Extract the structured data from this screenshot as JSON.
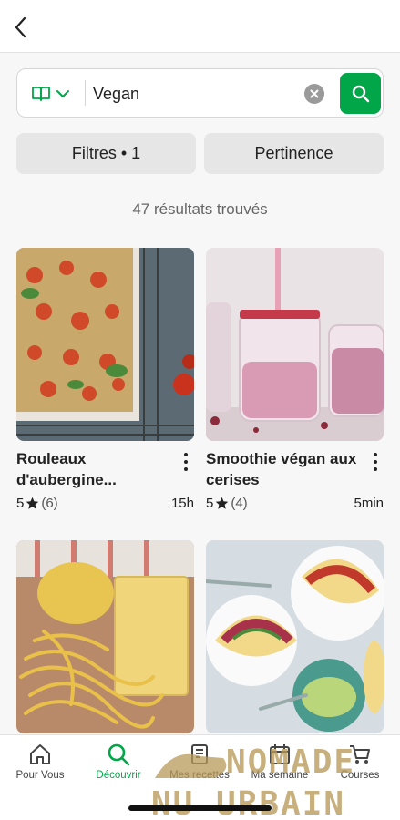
{
  "search": {
    "value": "Vegan"
  },
  "controls": {
    "filters_label": "Filtres • 1",
    "sort_label": "Pertinence"
  },
  "results": {
    "count_label": "47 résultats trouvés"
  },
  "recipes": [
    {
      "title": "Rouleaux d'aubergine...",
      "rating": "5",
      "reviews": "(6)",
      "duration": "15h"
    },
    {
      "title": "Smoothie végan aux cerises",
      "rating": "5",
      "reviews": "(4)",
      "duration": "5min"
    },
    {
      "title": "",
      "rating": "",
      "reviews": "",
      "duration": ""
    },
    {
      "title": "",
      "rating": "",
      "reviews": "",
      "duration": ""
    }
  ],
  "nav": [
    {
      "label": "Pour Vous",
      "icon": "home-icon",
      "active": false
    },
    {
      "label": "Découvrir",
      "icon": "search-icon",
      "active": true
    },
    {
      "label": "Mes recettes",
      "icon": "book-icon",
      "active": false
    },
    {
      "label": "Ma semaine",
      "icon": "calendar-icon",
      "active": false
    },
    {
      "label": "Courses",
      "icon": "cart-icon",
      "active": false
    }
  ],
  "watermark": {
    "line1": "NOMADE",
    "line2": "NU URBAIN"
  },
  "colors": {
    "accent": "#00a648",
    "background": "#f7f7f7",
    "pill": "#e6e6e6"
  }
}
